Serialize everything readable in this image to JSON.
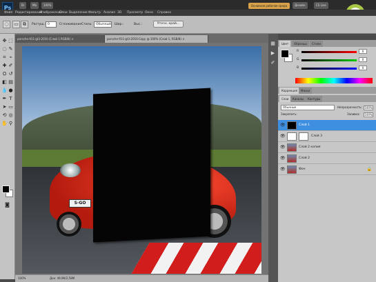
{
  "app": {
    "logo_text": "Ps"
  },
  "menu": [
    "Файл",
    "Редактирование",
    "Изображение",
    "Слои",
    "Выделение",
    "Фильтр",
    "Анализ",
    "3D",
    "Просмотр",
    "Окно",
    "Справка"
  ],
  "top": {
    "zoom": "100%",
    "workspace_label": "Основная рабочая среда",
    "design_label": "Дизайн",
    "cslive": "CS Live"
  },
  "options": {
    "feather_label": "Растуш.:",
    "feather_value": "0",
    "smooth_label": "Сглаживание",
    "style_label": "Стиль:",
    "width_label": "Шир.:",
    "height_label": "Выс.:",
    "refine_label": "Уточн. край..."
  },
  "tabs": [
    {
      "label": "porsche-911-gt3-2010 (Слой 1 RGB/8) ×",
      "active": false
    },
    {
      "label": "porsche-911-gt3-2010-Copy @ 100% (Слой 1, RGB/8) ×",
      "active": true
    }
  ],
  "status": {
    "zoom": "100%",
    "doc": "Док: 49,9К/2,58М"
  },
  "panels": {
    "color_tabs": [
      "Цвет",
      "Образцы",
      "Стили"
    ],
    "sliders": [
      {
        "label": "R",
        "value": "0",
        "color": "#e02020"
      },
      {
        "label": "G",
        "value": "0",
        "color": "#20b020"
      },
      {
        "label": "B",
        "value": "0",
        "color": "#2040e0"
      }
    ],
    "adjust_tabs": [
      "Коррекция",
      "Маски"
    ],
    "layers_tabs": [
      "Слои",
      "Каналы",
      "Контуры"
    ],
    "blend_mode": "Обычные",
    "opacity_label": "Непрозрачность:",
    "opacity_value": "100%",
    "lock_label": "Закрепить:",
    "fill_label": "Заливка:",
    "fill_value": "100%",
    "layers": [
      {
        "name": "Слой 1",
        "selected": true,
        "thumb": "#000000",
        "mask": false
      },
      {
        "name": "Слой 3",
        "selected": false,
        "thumb": "#ffffff",
        "mask": true
      },
      {
        "name": "Слой 2 копия",
        "selected": false,
        "thumb": "car",
        "mask": false
      },
      {
        "name": "Слой 2",
        "selected": false,
        "thumb": "car",
        "mask": false
      },
      {
        "name": "Фон",
        "selected": false,
        "thumb": "car",
        "mask": false
      }
    ]
  },
  "image": {
    "plate_text": "S-GO"
  }
}
